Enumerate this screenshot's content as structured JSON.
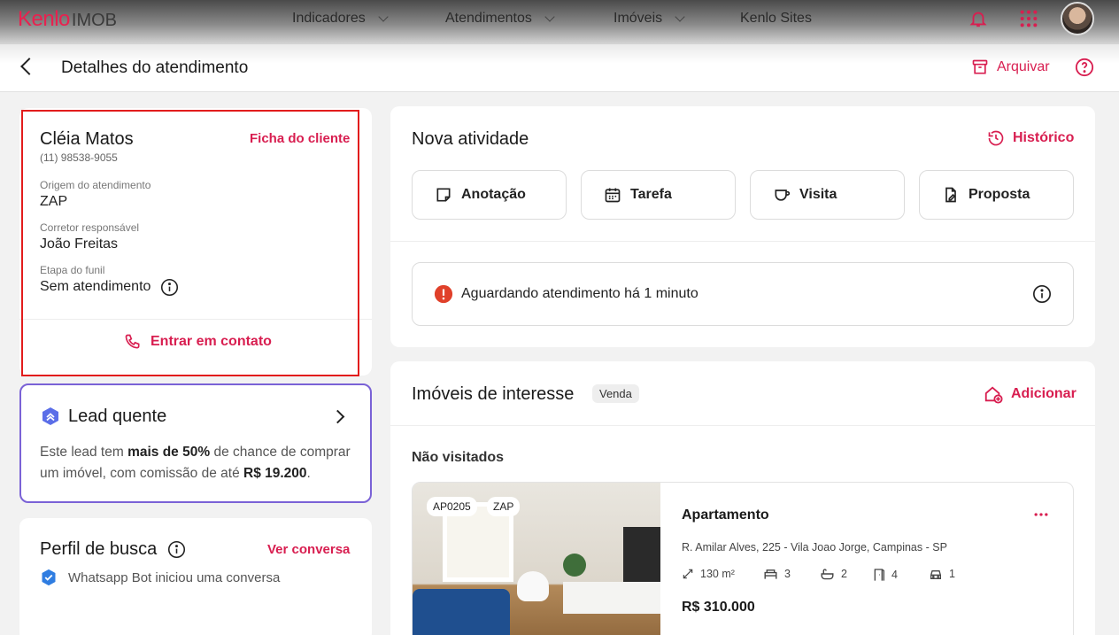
{
  "topbar": {
    "brand": "Kenlo",
    "brand_suffix": "IMOB",
    "nav": [
      {
        "label": "Indicadores"
      },
      {
        "label": "Atendimentos"
      },
      {
        "label": "Imóveis"
      },
      {
        "label": "Kenlo Sites"
      }
    ]
  },
  "subheader": {
    "title": "Detalhes do atendimento",
    "archive_label": "Arquivar"
  },
  "client": {
    "name": "Cléia Matos",
    "phone": "(11) 98538-9055",
    "ficha_label": "Ficha do cliente",
    "origin_label": "Origem do atendimento",
    "origin_value": "ZAP",
    "agent_label": "Corretor responsável",
    "agent_value": "João Freitas",
    "stage_label": "Etapa do funil",
    "stage_value": "Sem atendimento",
    "contact_label": "Entrar em contato"
  },
  "lead": {
    "title": "Lead quente",
    "text_1": "Este lead tem ",
    "text_bold_1": "mais de 50%",
    "text_2": " de chance de comprar um imóvel, com comissão de até ",
    "text_bold_2": "R$ 19.200",
    "text_3": "."
  },
  "perfil": {
    "title": "Perfil de busca",
    "link": "Ver conversa",
    "bot_text": "Whatsapp Bot iniciou uma conversa"
  },
  "atividade": {
    "title": "Nova atividade",
    "history_label": "Histórico",
    "buttons": [
      {
        "label": "Anotação"
      },
      {
        "label": "Tarefa"
      },
      {
        "label": "Visita"
      },
      {
        "label": "Proposta"
      }
    ],
    "status_text": "Aguardando atendimento há 1 minuto"
  },
  "imoveis": {
    "title": "Imóveis de interesse",
    "badge": "Venda",
    "add_label": "Adicionar",
    "group_label": "Não visitados",
    "property": {
      "code": "AP0205",
      "source": "ZAP",
      "type": "Apartamento",
      "address": "R. Amilar Alves, 225 - Vila Joao Jorge, Campinas - SP",
      "area": "130 m²",
      "bedrooms": "3",
      "bathrooms": "2",
      "suites": "4",
      "parking": "1",
      "price": "R$ 310.000"
    }
  },
  "colors": {
    "accent": "#d81e50",
    "lead_border": "#7a62d6",
    "alert": "#e0402a",
    "verified": "#2f7de1"
  }
}
